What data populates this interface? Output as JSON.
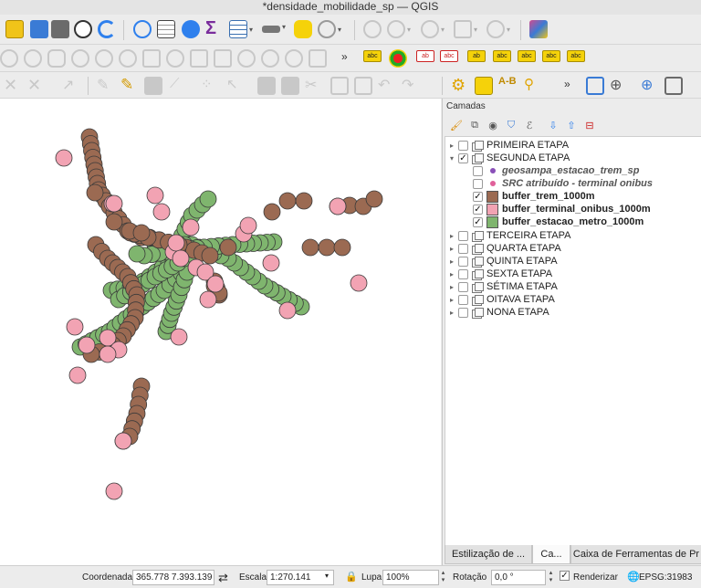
{
  "window": {
    "title": "*densidade_mobilidade_sp — QGIS"
  },
  "toolbars": {
    "row1": [
      {
        "name": "new-project-icon",
        "color": "#f0c419"
      },
      {
        "name": "open-project-icon",
        "color": "#3a7bd5"
      },
      {
        "name": "save-project-icon",
        "color": "#555555"
      },
      {
        "name": "clock-icon",
        "color": "#333333"
      },
      {
        "name": "refresh-icon",
        "color": "#2f80ed"
      },
      {
        "name": "identify-icon",
        "color": "#2f80ed"
      },
      {
        "name": "attribute-table-icon",
        "color": "#666666"
      },
      {
        "name": "processing-gear-icon",
        "color": "#2f80ed"
      },
      {
        "name": "sigma-icon",
        "color": "#7a2d9c"
      },
      {
        "name": "table-icon",
        "color": "#3a6fb0"
      },
      {
        "name": "ruler-icon",
        "color": "#555555"
      },
      {
        "name": "tooltip-icon",
        "color": "#f5d20a"
      },
      {
        "name": "search-icon",
        "color": "#999999"
      },
      {
        "name": "edit-icon",
        "color": "#aaaaaa"
      },
      {
        "name": "digitize-icon",
        "color": "#aaaaaa"
      },
      {
        "name": "shape-icon",
        "color": "#aaaaaa"
      },
      {
        "name": "vertex-icon",
        "color": "#aaaaaa"
      },
      {
        "name": "plugin-icon",
        "color": "#d14b8f"
      }
    ],
    "row3_labels": {
      "overflow": "»"
    }
  },
  "layers_panel": {
    "title": "Camadas",
    "items": [
      {
        "label": "PRIMEIRA ETAPA",
        "type": "group",
        "checked": false,
        "expanded": false
      },
      {
        "label": "SEGUNDA ETAPA",
        "type": "group",
        "checked": true,
        "expanded": true
      },
      {
        "label": "geosampa_estacao_trem_sp",
        "type": "point",
        "checked": false,
        "color": "#8a4fb8"
      },
      {
        "label": "SRC atribuído - terminal onibus",
        "type": "point",
        "checked": false,
        "color": "#e0609a"
      },
      {
        "label": "buffer_trem_1000m",
        "type": "polygon",
        "checked": true,
        "color": "#9b6a52"
      },
      {
        "label": "buffer_terminal_onibus_1000m",
        "type": "polygon",
        "checked": true,
        "color": "#f2a3b3"
      },
      {
        "label": "buffer_estacao_metro_1000m",
        "type": "polygon",
        "checked": true,
        "color": "#7fb56e"
      },
      {
        "label": "TERCEIRA ETAPA",
        "type": "group",
        "checked": false,
        "expanded": false
      },
      {
        "label": "QUARTA ETAPA",
        "type": "group",
        "checked": false,
        "expanded": false
      },
      {
        "label": "QUINTA ETAPA",
        "type": "group",
        "checked": false,
        "expanded": false
      },
      {
        "label": "SEXTA ETAPA",
        "type": "group",
        "checked": false,
        "expanded": false
      },
      {
        "label": "SÉTIMA ETAPA",
        "type": "group",
        "checked": false,
        "expanded": false
      },
      {
        "label": "OITAVA ETAPA",
        "type": "group",
        "checked": false,
        "expanded": false
      },
      {
        "label": "NONA ETAPA",
        "type": "group",
        "checked": false,
        "expanded": false
      }
    ],
    "tabs": [
      "Estilização de ...",
      "Ca...",
      "Caixa de Ferramentas de Pr"
    ]
  },
  "statusbar": {
    "coord_label": "Coordenada",
    "coord_value": "365.778  7.393.139",
    "scale_label": "Escala",
    "scale_value": "1:270.141",
    "magnifier_label": "Lupa",
    "magnifier_value": "100%",
    "rotation_label": "Rotação",
    "rotation_value": "0,0 °",
    "render_label": "Renderizar",
    "crs_label": "EPSG:31983"
  },
  "map_colors": {
    "trem": "#9b6a52",
    "terminal": "#f2a3b3",
    "metro": "#7fb56e",
    "outline": "#3a3a3a"
  }
}
